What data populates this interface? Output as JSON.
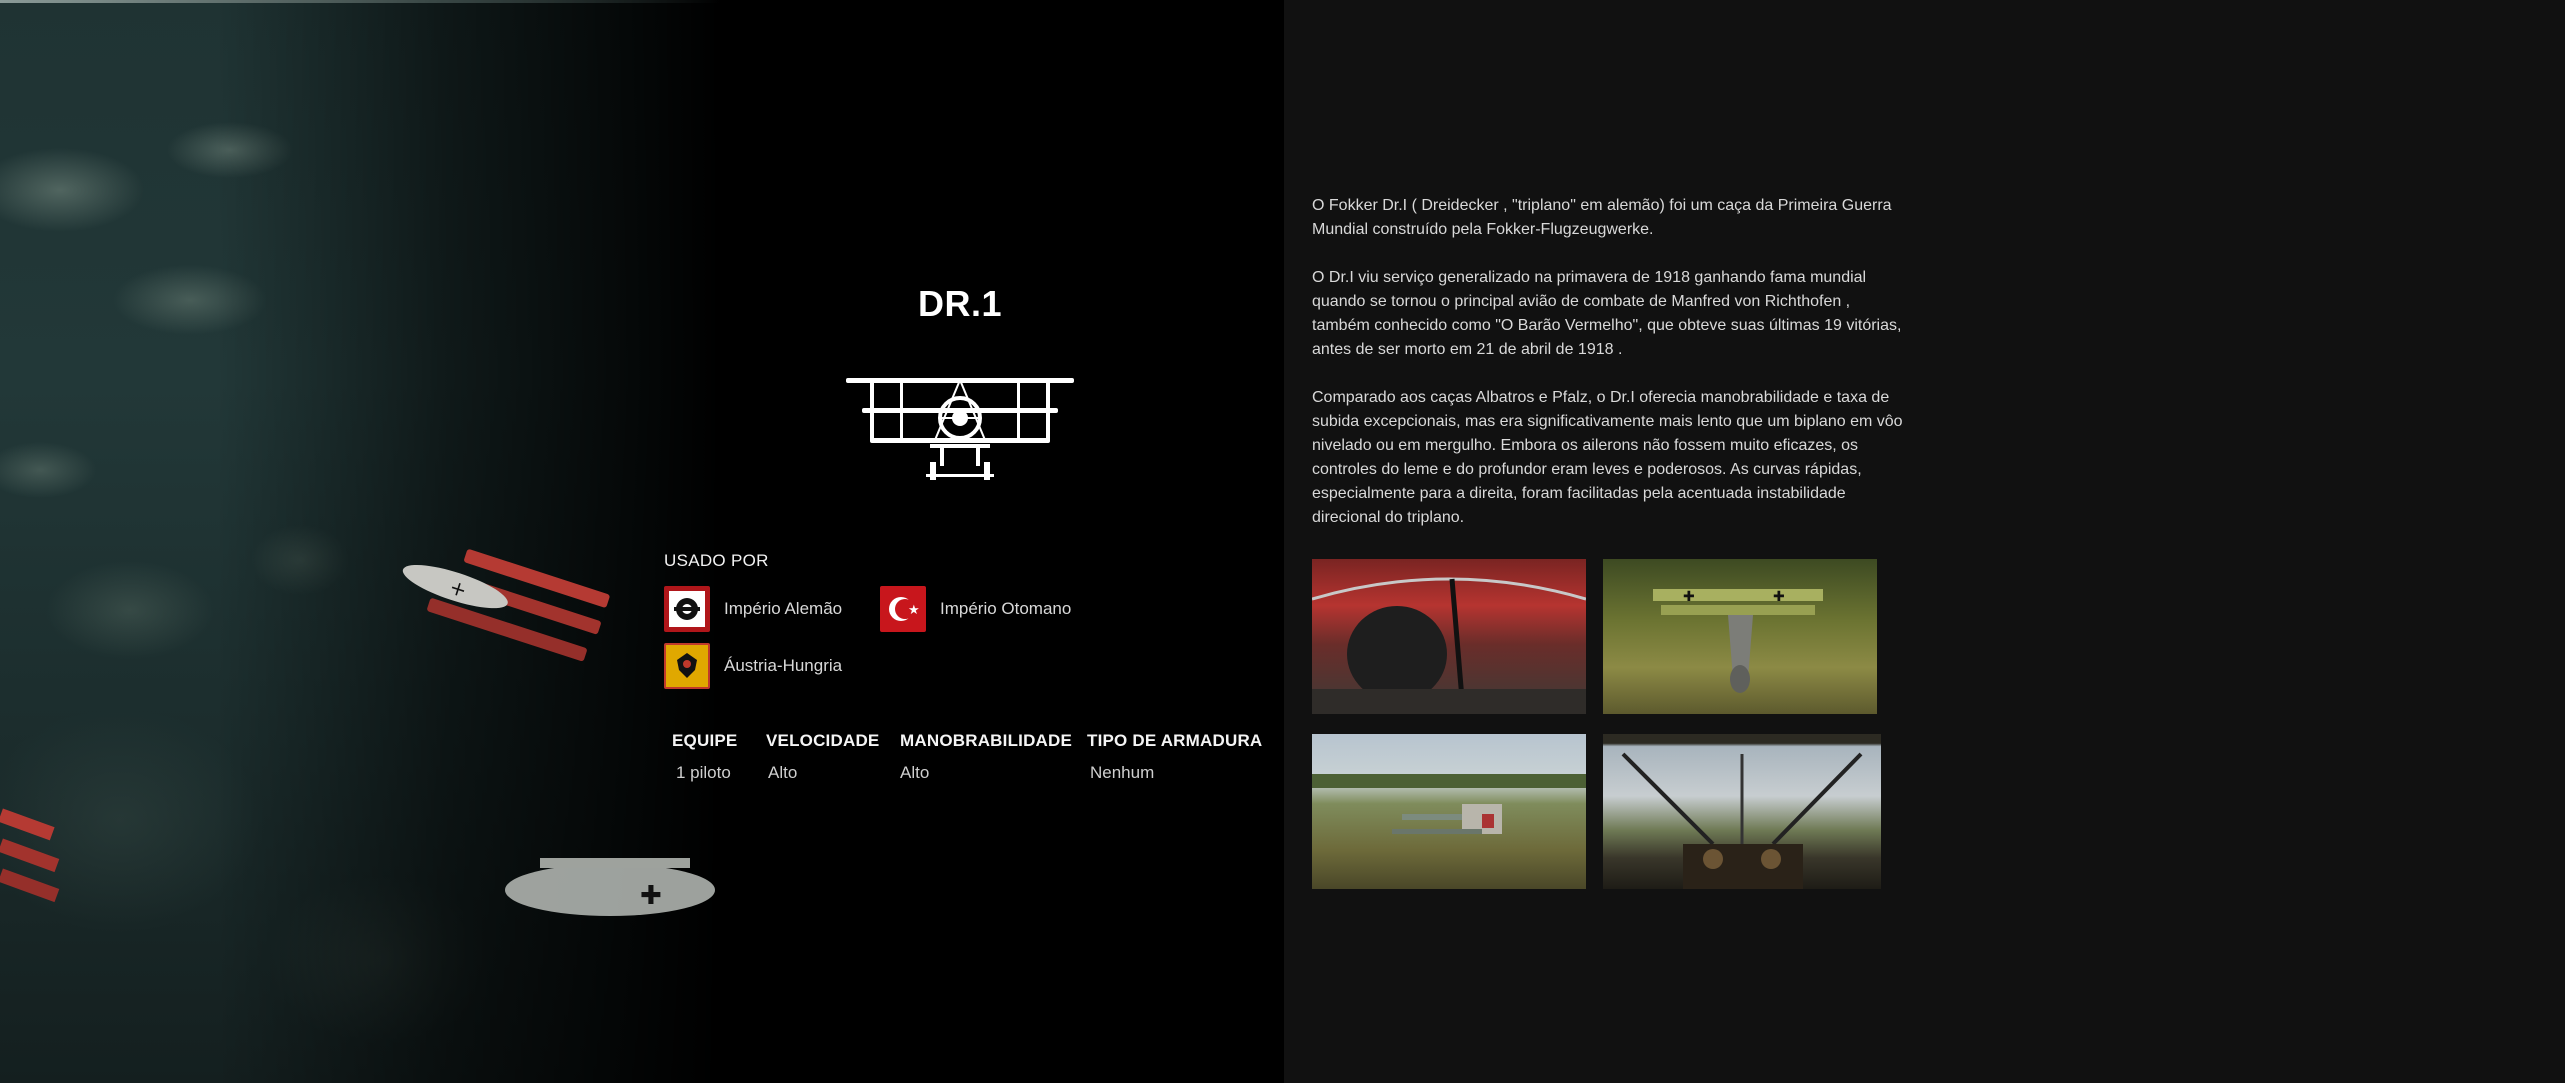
{
  "aircraft": {
    "title": "DR.1"
  },
  "used_by": {
    "heading": "USADO POR",
    "nations": [
      {
        "name": "Império Alemão",
        "icon": "german-empire-eagle-icon",
        "color": "#b0161a"
      },
      {
        "name": "Império Otomano",
        "icon": "ottoman-crescent-icon",
        "color": "#c8161c"
      },
      {
        "name": "Áustria-Hungria",
        "icon": "austria-hungary-eagle-icon",
        "color": "#e0a800"
      }
    ]
  },
  "stats": [
    {
      "label": "EQUIPE",
      "value": "1 piloto"
    },
    {
      "label": "VELOCIDADE",
      "value": "Alto"
    },
    {
      "label": "MANOBRABILIDADE",
      "value": "Alto"
    },
    {
      "label": "TIPO DE ARMADURA",
      "value": "Nenhum"
    }
  ],
  "description": [
    "O Fokker Dr.I ( Dreidecker , \"triplano\" em alemão) foi um caça da Primeira Guerra Mundial construído pela Fokker-Flugzeugwerke.",
    "O Dr.I viu serviço generalizado na primavera de 1918 ganhando fama mundial quando se tornou o principal avião de combate de Manfred von Richthofen , também conhecido como \"O Barão Vermelho\", que obteve suas últimas 19 vitórias, antes de ser morto em 21 de abril de 1918 .",
    "Comparado aos caças Albatros e Pfalz, o Dr.I oferecia manobrabilidade e taxa de subida excepcionais, mas era significativamente mais lento que um biplano em vôo nivelado ou em mergulho. Embora os ailerons não fossem muito eficazes, os controles do leme e do profundor eram leves e poderosos. As curvas rápidas, especialmente para a direita, foram facilitadas pela acentuada instabilidade direcional do triplano."
  ],
  "gallery": [
    {
      "icon": "cockpit-pilot-screenshot"
    },
    {
      "icon": "triplane-rear-view-screenshot"
    },
    {
      "icon": "triplanes-over-field-screenshot"
    },
    {
      "icon": "cockpit-view-screenshot"
    }
  ]
}
